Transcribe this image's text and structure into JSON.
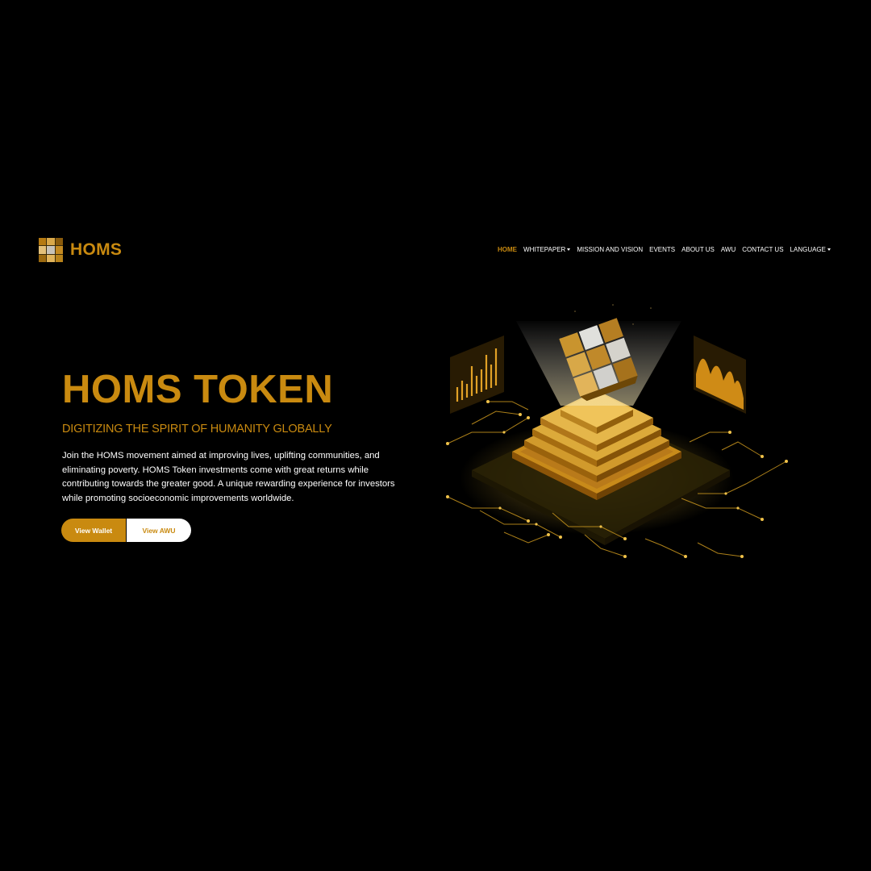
{
  "colors": {
    "background": "#000000",
    "accent": "#c98a10",
    "text": "#ffffff"
  },
  "brand": {
    "name": "HOMS",
    "logo_icon": "gold-grid-icon"
  },
  "nav": {
    "items": [
      {
        "label": "HOME",
        "active": true,
        "dropdown": false
      },
      {
        "label": "WHITEPAPER",
        "active": false,
        "dropdown": true
      },
      {
        "label": "MISSION AND VISION",
        "active": false,
        "dropdown": false
      },
      {
        "label": "EVENTS",
        "active": false,
        "dropdown": false
      },
      {
        "label": "ABOUT US",
        "active": false,
        "dropdown": false
      },
      {
        "label": "AWU",
        "active": false,
        "dropdown": false
      },
      {
        "label": "CONTACT US",
        "active": false,
        "dropdown": false
      },
      {
        "label": "LANGUAGE",
        "active": false,
        "dropdown": true
      }
    ]
  },
  "hero": {
    "title": "HOMS TOKEN",
    "subtitle": "DIGITIZING THE SPIRIT OF HUMANITY GLOBALLY",
    "description": "Join the HOMS movement aimed at improving lives, uplifting communities, and eliminating poverty. HOMS Token investments come with great returns while contributing towards the greater good. A unique rewarding experience for investors while promoting socioeconomic improvements worldwide.",
    "buttons": {
      "wallet_label": "View Wallet",
      "awu_label": "View AWU"
    }
  },
  "illustration": {
    "icon": "isometric-token-platform-icon"
  }
}
